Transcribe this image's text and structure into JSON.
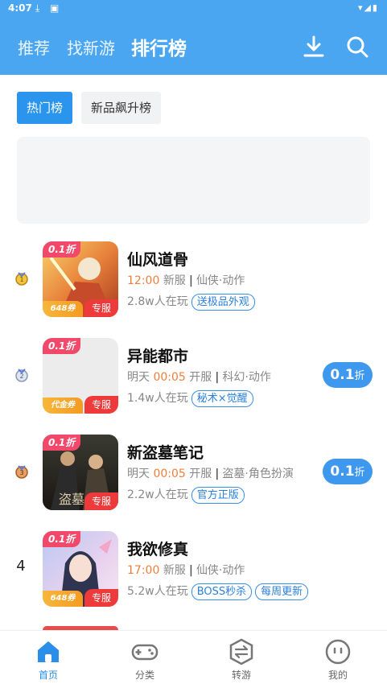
{
  "status": {
    "time": "4:07"
  },
  "nav": {
    "tabs": [
      {
        "label": "推荐",
        "active": false
      },
      {
        "label": "找新游",
        "active": false
      },
      {
        "label": "排行榜",
        "active": true
      }
    ]
  },
  "filters": [
    {
      "label": "热门榜",
      "active": true
    },
    {
      "label": "新品飙升榜",
      "active": false
    }
  ],
  "games": [
    {
      "rank": "1",
      "rank_style": "gold-medal",
      "name": "仙风道骨",
      "badge": "0.1折",
      "coupon": "648券",
      "tag": "专服",
      "day": "",
      "time": "12:00",
      "server": "新服",
      "genre": "仙侠·动作",
      "players": "2.8w人在玩",
      "pills": [
        "送极品外观"
      ],
      "discount": null
    },
    {
      "rank": "2",
      "rank_style": "silver-medal",
      "name": "异能都市",
      "badge": "0.1折",
      "coupon": "代金券",
      "tag": "专服",
      "day": "明天",
      "time": "00:05",
      "server": "开服",
      "genre": "科幻·动作",
      "players": "1.4w人在玩",
      "pills": [
        "秘术×觉醒"
      ],
      "discount": {
        "value": "0.1",
        "unit": "折"
      }
    },
    {
      "rank": "3",
      "rank_style": "bronze-medal",
      "name": "新盗墓笔记",
      "badge": "0.1折",
      "coupon": "",
      "tag": "专服",
      "day": "明天",
      "time": "00:05",
      "server": "开服",
      "genre": "盗墓·角色扮演",
      "players": "2.2w人在玩",
      "pills": [
        "官方正版"
      ],
      "discount": {
        "value": "0.1",
        "unit": "折"
      }
    },
    {
      "rank": "4",
      "rank_style": "number",
      "name": "我欲修真",
      "badge": "0.1折",
      "coupon": "648券",
      "tag": "专服",
      "day": "",
      "time": "17:00",
      "server": "新服",
      "genre": "仙侠·动作",
      "players": "5.2w人在玩",
      "pills": [
        "BOSS秒杀",
        "每周更新"
      ],
      "discount": null
    }
  ],
  "bottom_nav": [
    {
      "label": "首页",
      "icon": "home-icon",
      "active": true
    },
    {
      "label": "分类",
      "icon": "gamepad-icon",
      "active": false
    },
    {
      "label": "转游",
      "icon": "transfer-icon",
      "active": false
    },
    {
      "label": "我的",
      "icon": "profile-icon",
      "active": false
    }
  ],
  "colors": {
    "header": "#4aa6f1",
    "accent": "#2b95ee",
    "highlight": "#f07e3a",
    "badge": "#f2486a"
  }
}
